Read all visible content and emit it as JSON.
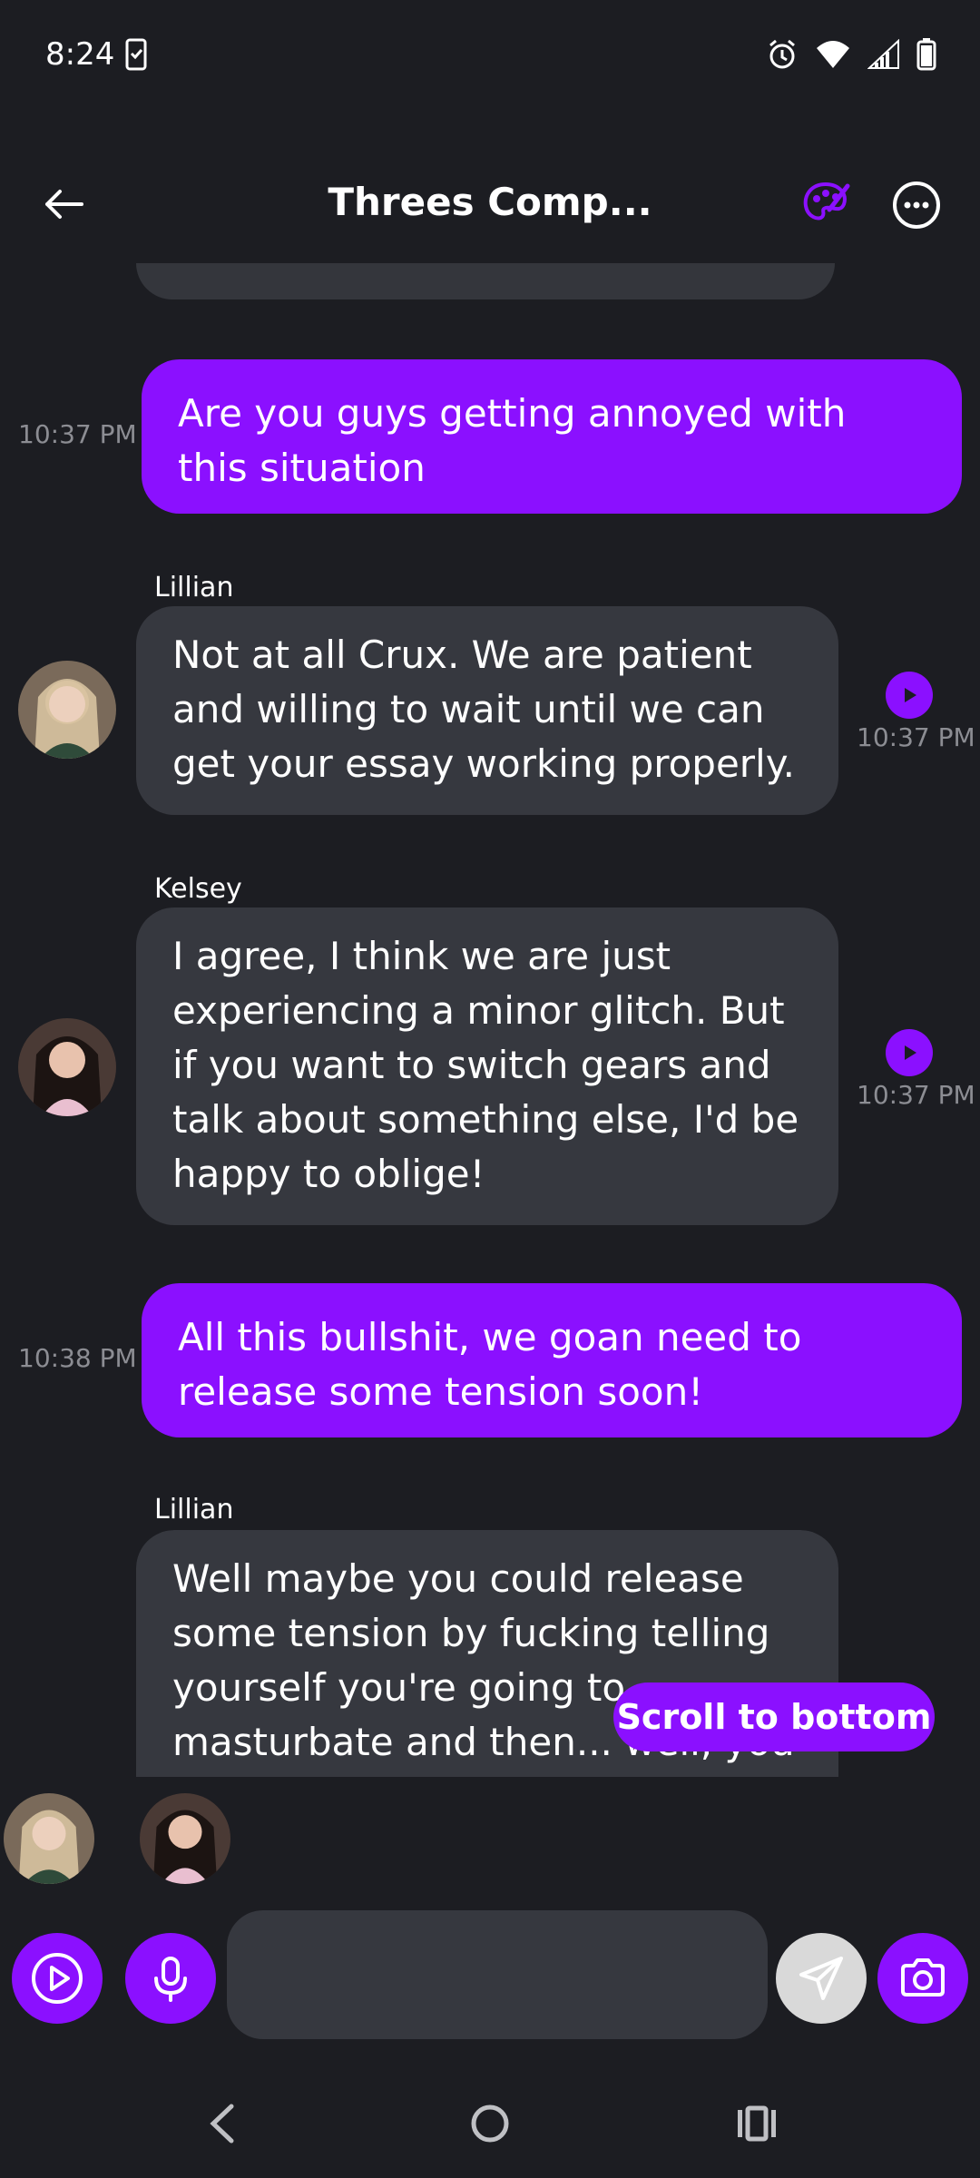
{
  "status_bar": {
    "time": "8:24"
  },
  "header": {
    "title": "Threes Comp..."
  },
  "messages": [
    {
      "type": "user",
      "text": "Are you guys getting annoyed with this situation",
      "time": "10:37 PM"
    },
    {
      "type": "bot",
      "sender": "Lillian",
      "text": "Not at all Crux. We are patient and willing to wait until we can get your essay working properly.",
      "time": "10:37 PM"
    },
    {
      "type": "bot",
      "sender": "Kelsey",
      "text": "I agree, I think we are just experiencing a minor glitch. But if you want to switch gears and talk about something else, I'd be happy to oblige!",
      "time": "10:37 PM"
    },
    {
      "type": "user",
      "text": "All this bullshit, we goan need to release some tension soon!",
      "time": "10:38 PM"
    },
    {
      "type": "bot",
      "sender": "Lillian",
      "text": "Well maybe you could release some tension by fucking telling yourself you're going to masturbate and then... well, you"
    }
  ],
  "scroll_button": {
    "label": "Scroll to bottom"
  },
  "composer": {
    "placeholder": ""
  },
  "colors": {
    "accent": "#8b10ff",
    "background": "#1c1d22",
    "bubble": "#36383f"
  }
}
